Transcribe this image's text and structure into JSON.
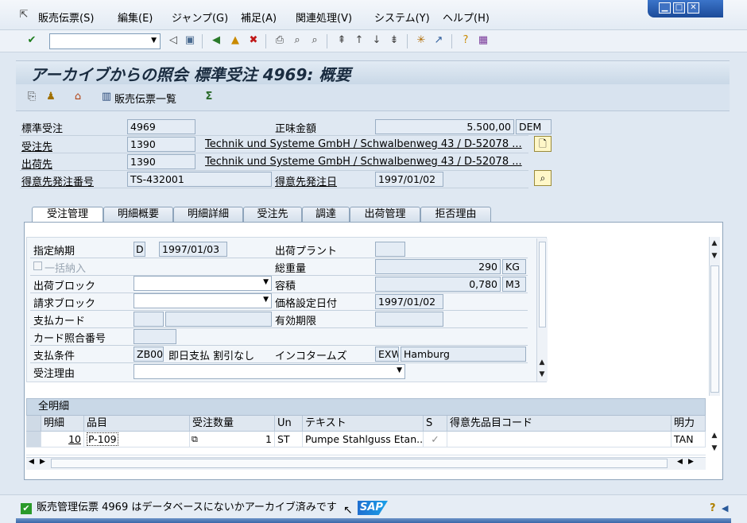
{
  "menu": {
    "items": [
      "販売伝票(S)",
      "編集(E)",
      "ジャンプ(G)",
      "補足(A)",
      "関連処理(V)",
      "システム(Y)",
      "ヘルプ(H)"
    ]
  },
  "window": {
    "minimize": "▁",
    "maximize": "□",
    "close": "✕"
  },
  "toolbar": {
    "command_value": ""
  },
  "title": "アーカイブからの照会 標準受注 4969: 概要",
  "apptoolbar": {
    "doc_list_label": "販売伝票一覧"
  },
  "header": {
    "order_type_label": "標準受注",
    "order_number": "4969",
    "net_value_label": "正味金額",
    "net_value": "5.500,00",
    "currency": "DEM",
    "sold_to_label": "受注先",
    "sold_to": "1390",
    "sold_to_text": "Technik und Systeme GmbH / Schwalbenweg 43 / D-52078 ...",
    "ship_to_label": "出荷先",
    "ship_to": "1390",
    "ship_to_text": "Technik und Systeme GmbH / Schwalbenweg 43 / D-52078 ...",
    "po_number_label": "得意先発注番号",
    "po_number": "TS-432001",
    "po_date_label": "得意先発注日",
    "po_date": "1997/01/02"
  },
  "tabs": [
    "受注管理",
    "明細概要",
    "明細詳細",
    "受注先",
    "調達",
    "出荷管理",
    "拒否理由"
  ],
  "order_mgmt": {
    "req_delivery_label": "指定納期",
    "req_delivery_type": "D",
    "req_delivery_date": "1997/01/03",
    "complete_delivery_label": "一括納入",
    "delivery_block_label": "出荷ブロック",
    "billing_block_label": "請求ブロック",
    "payment_card_label": "支払カード",
    "card_verif_label": "カード照合番号",
    "payment_terms_label": "支払条件",
    "payment_terms": "ZB00",
    "payment_terms_text": "即日支払 割引なし",
    "order_reason_label": "受注理由",
    "plant_label": "出荷プラント",
    "plant": "",
    "total_weight_label": "総重量",
    "total_weight": "290",
    "weight_unit": "KG",
    "volume_label": "容積",
    "volume": "0,780",
    "volume_unit": "M3",
    "pricing_date_label": "価格設定日付",
    "pricing_date": "1997/01/02",
    "valid_to_label": "有効期限",
    "valid_to": "",
    "incoterms_label": "インコタームズ",
    "incoterms": "EXW",
    "incoterms_place": "Hamburg"
  },
  "items_table": {
    "title": "全明細",
    "columns": [
      "明細",
      "品目",
      "受注数量",
      "Un",
      "テキスト",
      "S",
      "得意先品目コード",
      "明力"
    ],
    "rows": [
      {
        "item": "10",
        "material": "P-109",
        "qty": "1",
        "unit": "ST",
        "text": "Pumpe Stahlguss Etan...",
        "s": "✓",
        "cust_mat": "",
        "cat": "TAN"
      }
    ]
  },
  "status": {
    "message": "販売管理伝票 4969 はデータベースにないかアーカイブ済みです",
    "logo": "SAP"
  },
  "colors": {
    "accent": "#1c4b99",
    "panel_bg": "#dfe8f2",
    "title_text": "#1a2c40"
  }
}
